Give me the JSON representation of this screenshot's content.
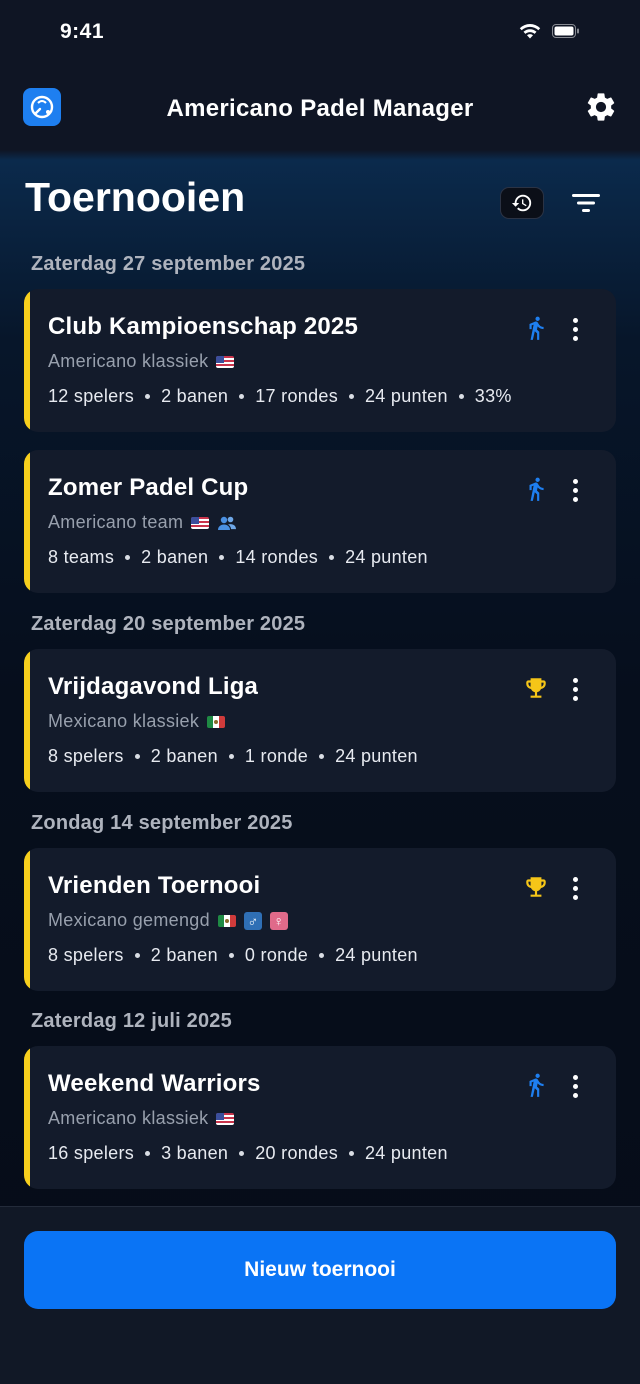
{
  "status_bar": {
    "time": "9:41"
  },
  "app": {
    "title": "Americano Padel Manager"
  },
  "page": {
    "title": "Toernooien"
  },
  "groups": [
    {
      "date": "Zaterdag 27 september 2025"
    },
    {
      "date": "Zaterdag 20 september 2025"
    },
    {
      "date": "Zondag 14 september 2025"
    },
    {
      "date": "Zaterdag 12 juli 2025"
    }
  ],
  "tournaments": [
    {
      "name": "Club Kampioenschap 2025",
      "format": "Americano klassiek",
      "flag": "us-flag",
      "status_icon": "running-icon",
      "meta": [
        "12 spelers",
        "2 banen",
        "17 rondes",
        "24 punten",
        "33%"
      ]
    },
    {
      "name": "Zomer Padel Cup",
      "format": "Americano team",
      "flag": "us-flag",
      "extra_icon": "team-icon",
      "status_icon": "running-icon",
      "meta": [
        "8 teams",
        "2 banen",
        "14 rondes",
        "24 punten"
      ]
    },
    {
      "name": "Vrijdagavond Liga",
      "format": "Mexicano klassiek",
      "flag": "mx-flag",
      "status_icon": "trophy-icon",
      "meta": [
        "8 spelers",
        "2 banen",
        "1 ronde",
        "24 punten"
      ]
    },
    {
      "name": "Vrienden Toernooi",
      "format": "Mexicano gemengd",
      "flag": "mx-flag",
      "gender_badges": [
        "♂",
        "♀"
      ],
      "status_icon": "trophy-icon",
      "meta": [
        "8 spelers",
        "2 banen",
        "0 ronde",
        "24 punten"
      ]
    },
    {
      "name": "Weekend Warriors",
      "format": "Americano klassiek",
      "flag": "us-flag",
      "status_icon": "running-icon",
      "meta": [
        "16 spelers",
        "3 banen",
        "20 rondes",
        "24 punten"
      ]
    }
  ],
  "actions": {
    "new_tournament": "Nieuw toernooi"
  },
  "colors": {
    "accent_bar": "#f7cf1d",
    "primary_button": "#0a74f5",
    "running_icon": "#1e7ff0",
    "trophy_icon": "#f5c518",
    "card_bg": "#131b2b"
  }
}
